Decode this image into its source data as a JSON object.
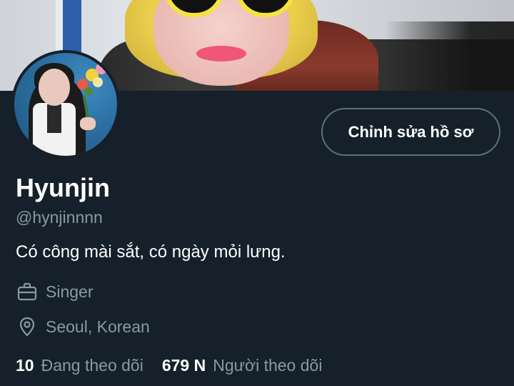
{
  "profile": {
    "edit_button_label": "Chỉnh sửa hồ sơ",
    "display_name": "Hyunjin",
    "handle": "@hynjinnnn",
    "bio": "Có công mài sắt, có ngày mỏi lưng.",
    "job": "Singer",
    "job_icon": "briefcase-icon",
    "location": "Seoul, Korean",
    "location_icon": "location-pin-icon",
    "following_count": "10",
    "following_label": "Đang theo dõi",
    "followers_count": "679 N",
    "followers_label": "Người theo dõi"
  },
  "colors": {
    "background": "#15202b",
    "secondary_text": "#8899a6",
    "button_border": "#5b6f80",
    "primary_text": "#ffffff"
  }
}
